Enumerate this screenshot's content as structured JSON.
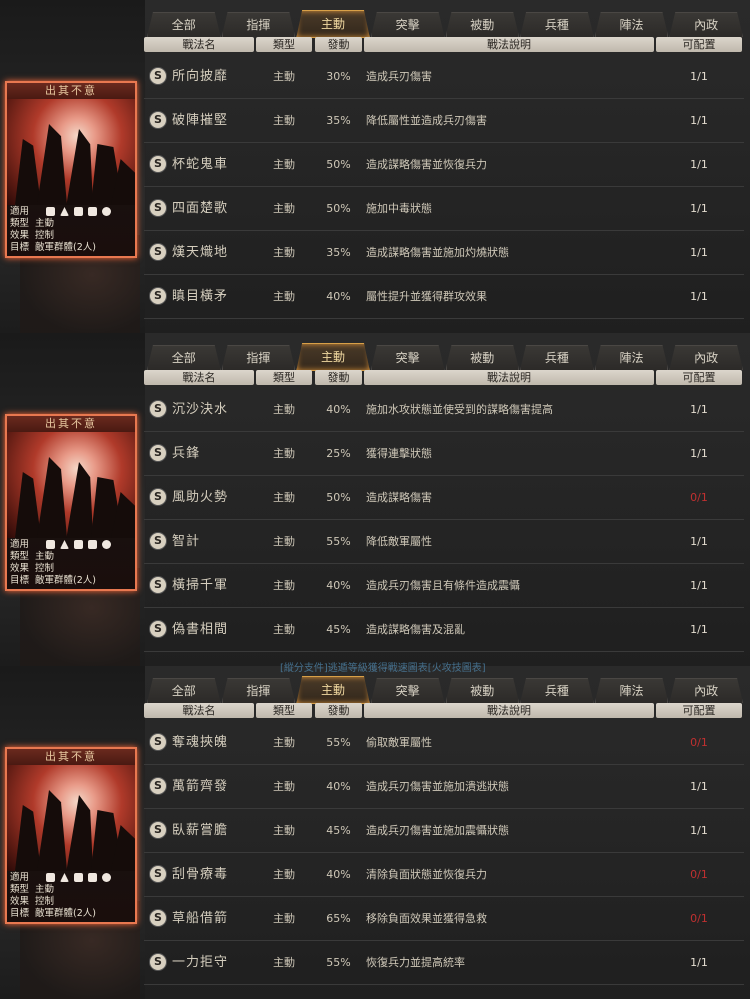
{
  "tabs": [
    "全部",
    "指揮",
    "主動",
    "突擊",
    "被動",
    "兵種",
    "陣法",
    "內政"
  ],
  "active_tab": "主動",
  "headers": {
    "name": "戰法名",
    "type": "類型",
    "rate": "發動",
    "desc": "戰法說明",
    "cfg": "可配置"
  },
  "card": {
    "title": "出其不意",
    "apply_label": "適用",
    "type_label": "類型",
    "type_value": "主動",
    "effect_label": "效果",
    "effect_value": "控制",
    "target_label": "目標",
    "target_value": "敵軍群體(2人)",
    "unit_icons": [
      "cavalry-icon",
      "shield-icon",
      "archer-icon",
      "spear-icon",
      "siege-icon"
    ]
  },
  "banner": "[縱分支件]逃遁等級獲得戰速圖表[火攻技圖表]",
  "panels": [
    {
      "rows": [
        {
          "name": "所向披靡",
          "type": "主動",
          "rate": "30%",
          "desc": "造成兵刃傷害",
          "cfg": "1/1",
          "red": false
        },
        {
          "name": "破陣摧堅",
          "type": "主動",
          "rate": "35%",
          "desc": "降低屬性並造成兵刃傷害",
          "cfg": "1/1",
          "red": false
        },
        {
          "name": "杯蛇鬼車",
          "type": "主動",
          "rate": "50%",
          "desc": "造成謀略傷害並恢復兵力",
          "cfg": "1/1",
          "red": false
        },
        {
          "name": "四面楚歌",
          "type": "主動",
          "rate": "50%",
          "desc": "施加中毒狀態",
          "cfg": "1/1",
          "red": false
        },
        {
          "name": "熯天熾地",
          "type": "主動",
          "rate": "35%",
          "desc": "造成謀略傷害並施加灼燒狀態",
          "cfg": "1/1",
          "red": false
        },
        {
          "name": "瞋目橫矛",
          "type": "主動",
          "rate": "40%",
          "desc": "屬性提升並獲得群攻效果",
          "cfg": "1/1",
          "red": false
        }
      ]
    },
    {
      "rows": [
        {
          "name": "沉沙決水",
          "type": "主動",
          "rate": "40%",
          "desc": "施加水攻狀態並使受到的謀略傷害提高",
          "cfg": "1/1",
          "red": false
        },
        {
          "name": "兵鋒",
          "type": "主動",
          "rate": "25%",
          "desc": "獲得連擊狀態",
          "cfg": "1/1",
          "red": false
        },
        {
          "name": "風助火勢",
          "type": "主動",
          "rate": "50%",
          "desc": "造成謀略傷害",
          "cfg": "0/1",
          "red": true
        },
        {
          "name": "智計",
          "type": "主動",
          "rate": "55%",
          "desc": "降低敵軍屬性",
          "cfg": "1/1",
          "red": false
        },
        {
          "name": "橫掃千軍",
          "type": "主動",
          "rate": "40%",
          "desc": "造成兵刃傷害且有條件造成震懾",
          "cfg": "1/1",
          "red": false
        },
        {
          "name": "偽書相間",
          "type": "主動",
          "rate": "45%",
          "desc": "造成謀略傷害及混亂",
          "cfg": "1/1",
          "red": false
        }
      ]
    },
    {
      "rows": [
        {
          "name": "奪魂挾魄",
          "type": "主動",
          "rate": "55%",
          "desc": "偷取敵軍屬性",
          "cfg": "0/1",
          "red": true
        },
        {
          "name": "萬箭齊發",
          "type": "主動",
          "rate": "40%",
          "desc": "造成兵刃傷害並施加潰逃狀態",
          "cfg": "1/1",
          "red": false
        },
        {
          "name": "臥薪嘗膽",
          "type": "主動",
          "rate": "45%",
          "desc": "造成兵刃傷害並施加震懾狀態",
          "cfg": "1/1",
          "red": false
        },
        {
          "name": "刮骨療毒",
          "type": "主動",
          "rate": "40%",
          "desc": "清除負面狀態並恢復兵力",
          "cfg": "0/1",
          "red": true
        },
        {
          "name": "草船借箭",
          "type": "主動",
          "rate": "65%",
          "desc": "移除負面效果並獲得急救",
          "cfg": "0/1",
          "red": true
        },
        {
          "name": "一力拒守",
          "type": "主動",
          "rate": "55%",
          "desc": "恢復兵力並提高統率",
          "cfg": "1/1",
          "red": false
        }
      ]
    }
  ]
}
